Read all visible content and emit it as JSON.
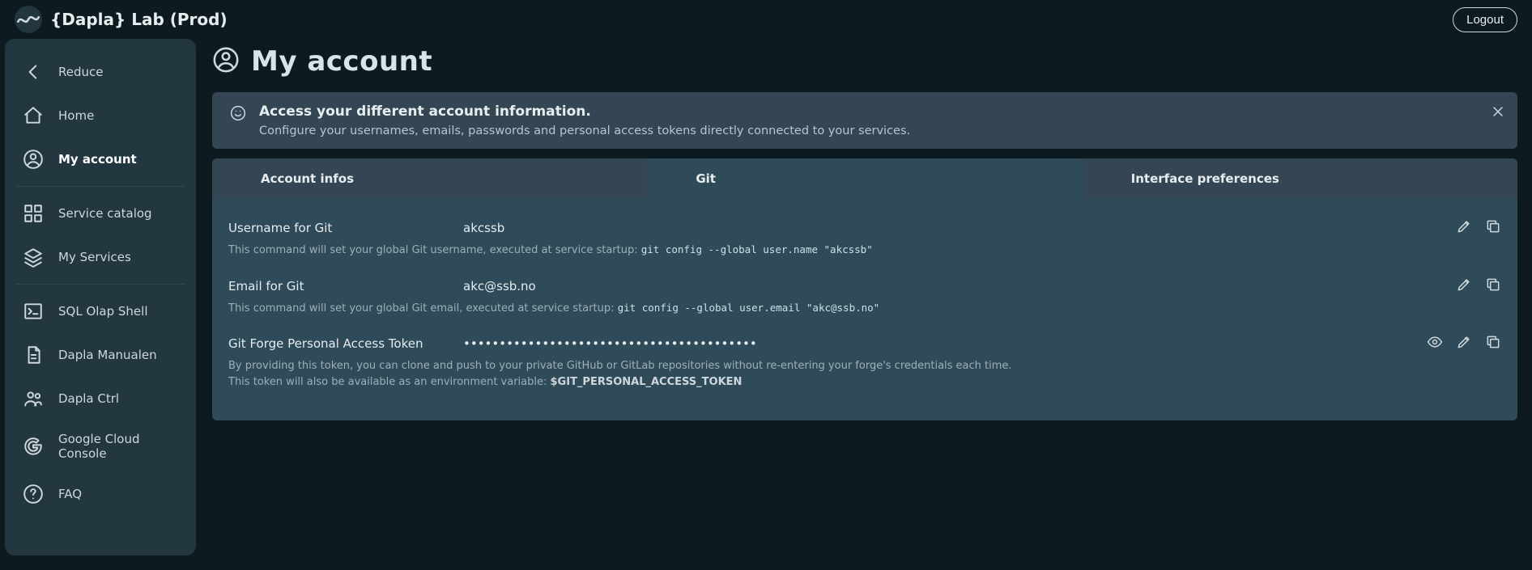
{
  "header": {
    "app_name": "{Dapla} Lab (Prod)",
    "logout": "Logout"
  },
  "sidebar": {
    "reduce": "Reduce",
    "home": "Home",
    "account": "My account",
    "catalog": "Service catalog",
    "services": "My Services",
    "sql": "SQL Olap Shell",
    "manual": "Dapla Manualen",
    "ctrl": "Dapla Ctrl",
    "gcp": "Google Cloud Console",
    "faq": "FAQ"
  },
  "page": {
    "title": "My account"
  },
  "banner": {
    "title": "Access your different account information.",
    "subtitle": "Configure your usernames, emails, passwords and personal access tokens directly connected to your services."
  },
  "tabs": {
    "info": "Account infos",
    "git": "Git",
    "prefs": "Interface preferences"
  },
  "git": {
    "username_label": "Username for Git",
    "username_value": "akcssb",
    "username_help_text": "This command will set your global Git username, executed at service startup: ",
    "username_help_code": "git config --global user.name \"akcssb\"",
    "email_label": "Email for Git",
    "email_value": "akc@ssb.no",
    "email_help_text": "This command will set your global Git email, executed at service startup: ",
    "email_help_code": "git config --global user.email \"akc@ssb.no\"",
    "token_label": "Git Forge Personal Access Token",
    "token_value": "•••••••••••••••••••••••••••••••••••••••••",
    "token_help_line1": "By providing this token, you can clone and push to your private GitHub or GitLab repositories without re-entering your forge's credentials each time.",
    "token_help_line2a": "This token will also be available as an environment variable: ",
    "token_help_env": "$GIT_PERSONAL_ACCESS_TOKEN"
  }
}
